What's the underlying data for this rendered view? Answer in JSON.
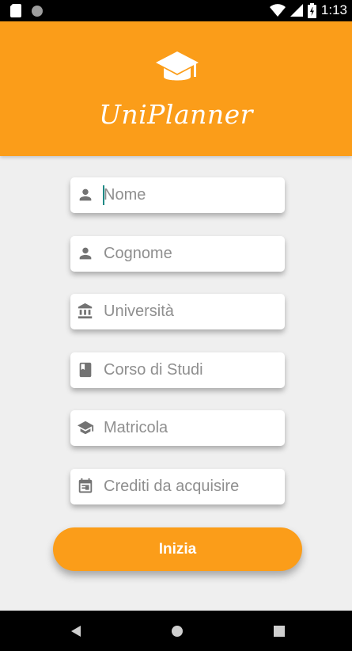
{
  "status_bar": {
    "time": "1:13",
    "icons": [
      "sd-card-icon",
      "circle-notification-icon",
      "wifi-icon",
      "signal-icon",
      "battery-icon"
    ]
  },
  "app": {
    "title": "UniPlanner",
    "logo_icon": "graduation-cap-icon",
    "header_color": "#fb9d19"
  },
  "form": {
    "fields": [
      {
        "icon": "person-icon",
        "placeholder": "Nome",
        "value": ""
      },
      {
        "icon": "person-icon",
        "placeholder": "Cognome",
        "value": ""
      },
      {
        "icon": "university-icon",
        "placeholder": "Università",
        "value": ""
      },
      {
        "icon": "book-icon",
        "placeholder": "Corso di Studi",
        "value": ""
      },
      {
        "icon": "graduation-cap-icon",
        "placeholder": "Matricola",
        "value": ""
      },
      {
        "icon": "calendar-icon",
        "placeholder": "Crediti da acquisire",
        "value": ""
      }
    ],
    "submit_label": "Inizia"
  },
  "nav_bar": {
    "buttons": [
      "back-icon",
      "home-icon",
      "recents-icon"
    ]
  }
}
